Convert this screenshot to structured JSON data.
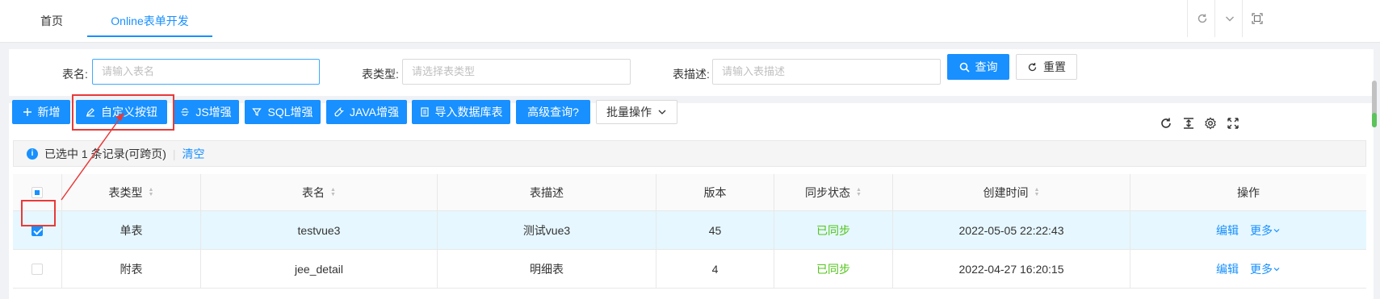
{
  "tabs": [
    {
      "label": "首页"
    },
    {
      "label": "Online表单开发"
    }
  ],
  "search": {
    "table_name_label": "表名:",
    "table_name_placeholder": "请输入表名",
    "table_type_label": "表类型:",
    "table_type_placeholder": "请选择表类型",
    "table_desc_label": "表描述:",
    "table_desc_placeholder": "请输入表描述",
    "query_label": "查询",
    "reset_label": "重置"
  },
  "toolbar": {
    "add_label": "新增",
    "custom_button_label": "自定义按钮",
    "js_label": "JS增强",
    "sql_label": "SQL增强",
    "java_label": "JAVA增强",
    "import_label": "导入数据库表",
    "advanced_query_label": "高级查询?",
    "batch_label": "批量操作"
  },
  "selection": {
    "text": "已选中 1 条记录(可跨页)",
    "clear_label": "清空"
  },
  "table": {
    "headers": [
      "表类型",
      "表名",
      "表描述",
      "版本",
      "同步状态",
      "创建时间",
      "操作"
    ],
    "rows": [
      {
        "type": "单表",
        "name": "testvue3",
        "desc": "测试vue3",
        "version": "45",
        "sync": "已同步",
        "created": "2022-05-05 22:22:43",
        "edit": "编辑",
        "more": "更多",
        "checked": true
      },
      {
        "type": "附表",
        "name": "jee_detail",
        "desc": "明细表",
        "version": "4",
        "sync": "已同步",
        "created": "2022-04-27 16:20:15",
        "edit": "编辑",
        "more": "更多",
        "checked": false
      }
    ]
  },
  "colors": {
    "primary": "#1890ff",
    "success": "#52c41a",
    "annotation": "#e83a3a"
  }
}
